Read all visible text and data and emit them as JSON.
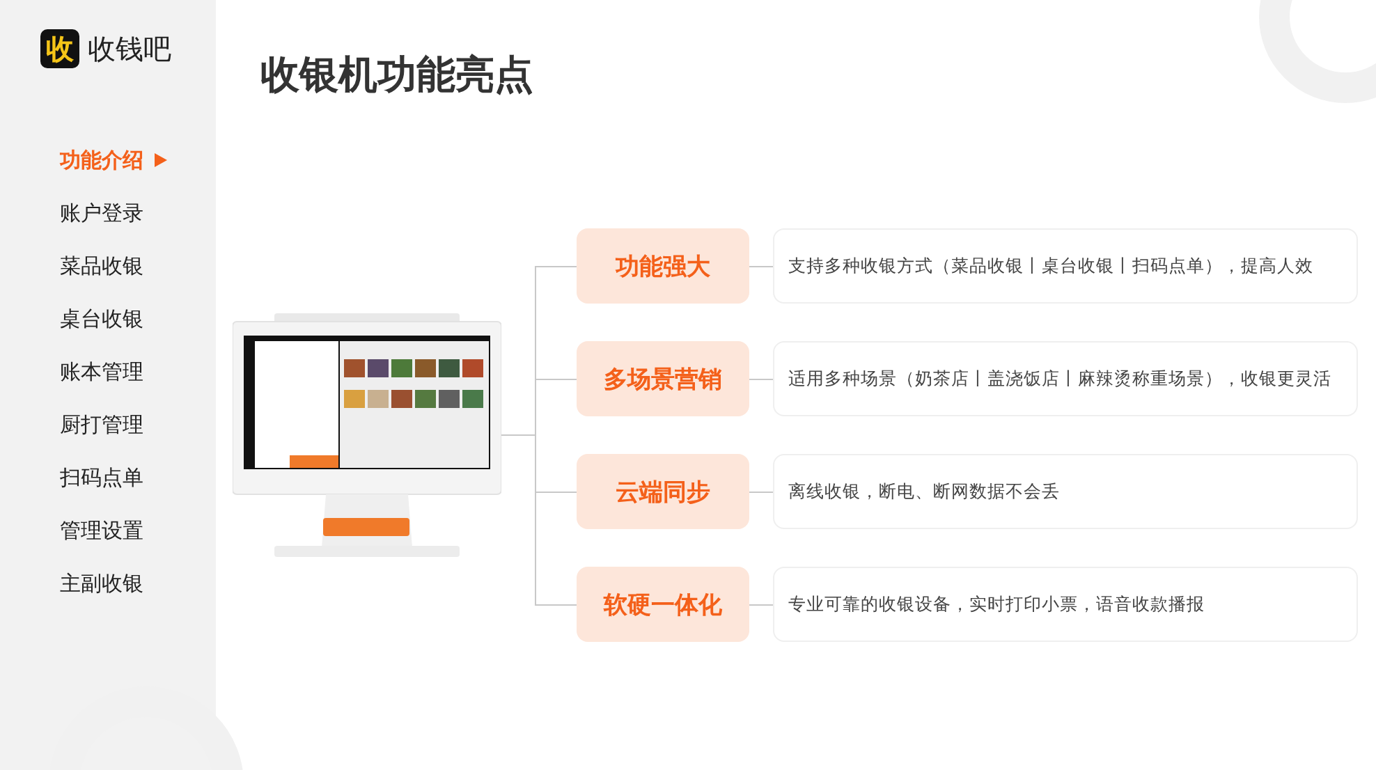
{
  "logo": {
    "mark": "收",
    "name": "收钱吧"
  },
  "sidebar": {
    "items": [
      {
        "label": "功能介绍",
        "selected": true
      },
      {
        "label": "账户登录",
        "selected": false
      },
      {
        "label": "菜品收银",
        "selected": false
      },
      {
        "label": "桌台收银",
        "selected": false
      },
      {
        "label": "账本管理",
        "selected": false
      },
      {
        "label": "厨打管理",
        "selected": false
      },
      {
        "label": "扫码点单",
        "selected": false
      },
      {
        "label": "管理设置",
        "selected": false
      },
      {
        "label": "主副收银",
        "selected": false
      }
    ]
  },
  "title": "收银机功能亮点",
  "features": [
    {
      "tag": "功能强大",
      "description": "支持多种收银方式（菜品收银丨桌台收银丨扫码点单），提高人效"
    },
    {
      "tag": "多场景营销",
      "description": "适用多种场景（奶茶店丨盖浇饭店丨麻辣烫称重场景），收银更灵活"
    },
    {
      "tag": "云端同步",
      "description": "离线收银，断电、断网数据不会丢"
    },
    {
      "tag": "软硬一体化",
      "description": "专业可靠的收银设备，实时打印小票，语音收款播报"
    }
  ]
}
